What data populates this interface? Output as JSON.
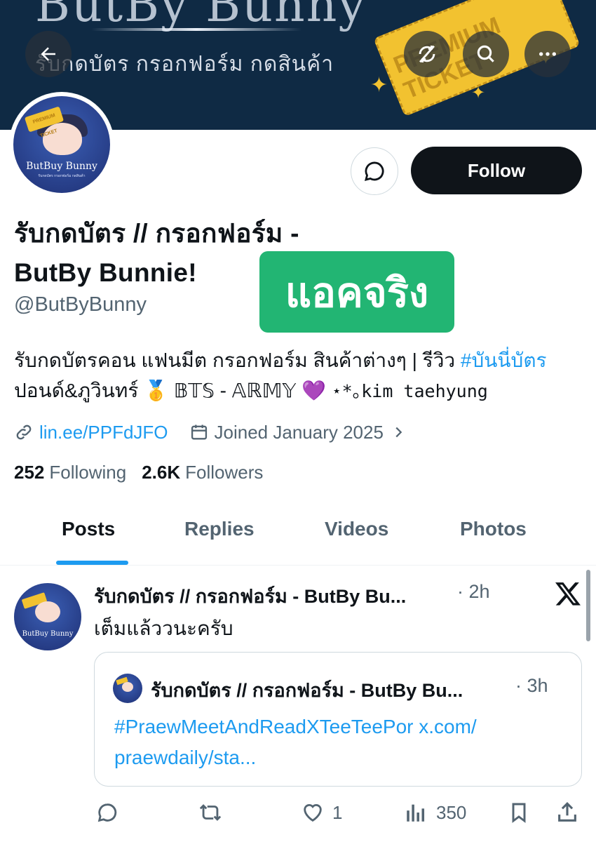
{
  "banner": {
    "brand": "ButBy Bunny",
    "subtitle": "รับกดบัตร กรอกฟอร์ม กดสินค้า",
    "ticket_text": "PREMIUM TICKET"
  },
  "header_buttons": {
    "back": "back-arrow-icon",
    "translate": "no-sync-icon",
    "search": "search-icon",
    "more": "more-icon"
  },
  "avatar": {
    "label": "ButBuy Bunny",
    "tiny": "รับกดบัตร กรอกฟอร์ม กดสินค้า"
  },
  "profile": {
    "follow_label": "Follow",
    "name_line1": "รับกดบัตร // กรอกฟอร์ม -",
    "name_line2": "ButBy Bunnie!",
    "handle": "@ButByBunny",
    "badge": "แอคจริง",
    "bio_part1": "รับกดบัตรคอน แฟนมีต กรอกฟอร์ม สินค้าต่างๆ | รีวิว ",
    "bio_hashtag": "#บันนี่บัตร",
    "bio_part2": " ปอนด์&ภูวินทร์ 🥇 𝔹𝕋𝕊 - 𝔸ℝ𝕄𝕐 💜 ",
    "bio_part3": "⋆*｡kim taehyung",
    "link": "lin.ee/PPFdJFO",
    "joined": "Joined January 2025",
    "following_count": "252",
    "following_label": "Following",
    "followers_count": "2.6K",
    "followers_label": "Followers"
  },
  "tabs": [
    "Posts",
    "Replies",
    "Videos",
    "Photos"
  ],
  "tweet": {
    "name": "รับกดบัตร // กรอกฟอร์ม - ButBy Bu...",
    "time": "· 2h",
    "text": "เต็มแล้ววนะครับ",
    "avatar_label": "ButBuy Bunny",
    "quote": {
      "name": "รับกดบัตร // กรอกฟอร์ม - ButBy Bu...",
      "time": "· 3h",
      "text_line1": "#PraewMeetAndReadXTeeTeePor x.com/",
      "text_line2": "praewdaily/sta..."
    },
    "likes": "1",
    "views": "350"
  },
  "colors": {
    "accent": "#1d9bf0",
    "banner_bg": "#0f2a44",
    "badge_bg": "#22b573",
    "text_secondary": "#536471"
  }
}
